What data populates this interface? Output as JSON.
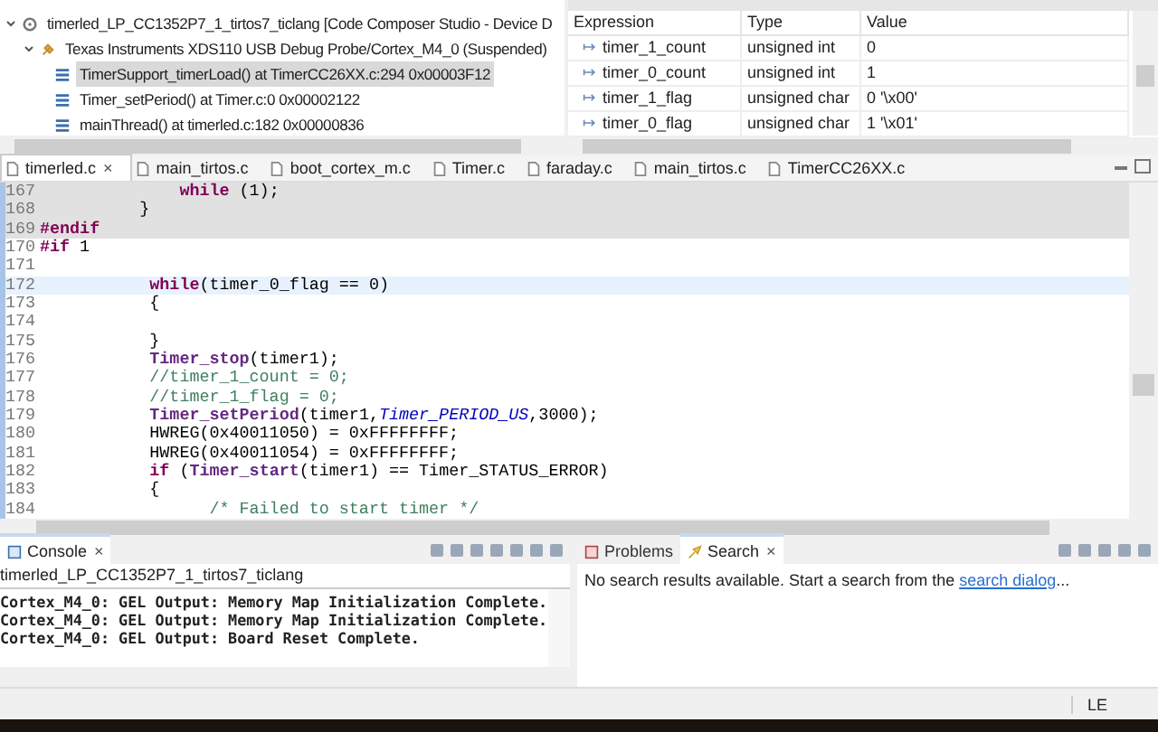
{
  "debug_tree": [
    {
      "label": "timerled_LP_CC1352P7_1_tirtos7_ticlang [Code Composer Studio - Device D",
      "kind": "project",
      "expanded": true,
      "children": [
        {
          "label": "Texas Instruments XDS110 USB Debug Probe/Cortex_M4_0 (Suspended)",
          "kind": "probe",
          "expanded": true,
          "children": [
            {
              "label": "TimerSupport_timerLoad() at TimerCC26XX.c:294 0x00003F12",
              "kind": "frame",
              "selected": true
            },
            {
              "label": "Timer_setPeriod() at Timer.c:0 0x00002122",
              "kind": "frame",
              "selected": false
            },
            {
              "label": "mainThread() at timerled.c:182 0x00000836",
              "kind": "frame",
              "selected": false
            }
          ]
        }
      ]
    }
  ],
  "expressions": {
    "columns": [
      "Expression",
      "Type",
      "Value"
    ],
    "rows": [
      {
        "expression": "timer_1_count",
        "type": "unsigned int",
        "value": "0"
      },
      {
        "expression": "timer_0_count",
        "type": "unsigned int",
        "value": "1"
      },
      {
        "expression": "timer_1_flag",
        "type": "unsigned char",
        "value": "0 '\\x00'"
      },
      {
        "expression": "timer_0_flag",
        "type": "unsigned char",
        "value": "1 '\\x01'"
      }
    ]
  },
  "editor_tabs": [
    {
      "label": "timerled.c",
      "close": "×",
      "selected": true
    },
    {
      "label": "main_tirtos.c",
      "selected": false
    },
    {
      "label": "boot_cortex_m.c",
      "selected": false
    },
    {
      "label": "Timer.c",
      "selected": false
    },
    {
      "label": "faraday.c",
      "selected": false
    },
    {
      "label": "main_tirtos.c",
      "selected": false
    },
    {
      "label": "TimerCC26XX.c",
      "selected": false
    }
  ],
  "code": [
    {
      "number": "167",
      "inactive": true,
      "current": false,
      "tokens": [
        {
          "text": "              while",
          "kind": "keyword"
        },
        {
          "text": " (1);",
          "kind": "plain"
        }
      ]
    },
    {
      "number": "168",
      "inactive": true,
      "current": false,
      "tokens": [
        {
          "text": "          }",
          "kind": "plain"
        }
      ]
    },
    {
      "number": "169",
      "inactive": true,
      "current": false,
      "tokens": [
        {
          "text": "#endif",
          "kind": "keyword"
        }
      ]
    },
    {
      "number": "170",
      "inactive": false,
      "current": false,
      "tokens": [
        {
          "text": "#if",
          "kind": "keyword"
        },
        {
          "text": " 1",
          "kind": "plain"
        }
      ]
    },
    {
      "number": "171",
      "inactive": false,
      "current": false
    },
    {
      "number": "172",
      "inactive": false,
      "current": true,
      "tokens": [
        {
          "text": "           while",
          "kind": "keyword"
        },
        {
          "text": "(timer_0_flag == 0)",
          "kind": "plain"
        }
      ]
    },
    {
      "number": "173",
      "inactive": false,
      "current": false,
      "tokens": [
        {
          "text": "           {",
          "kind": "plain"
        }
      ]
    },
    {
      "number": "174",
      "inactive": false,
      "current": false
    },
    {
      "number": "175",
      "inactive": false,
      "current": false,
      "tokens": [
        {
          "text": "           }",
          "kind": "plain"
        }
      ]
    },
    {
      "number": "176",
      "inactive": false,
      "current": false,
      "tokens": [
        {
          "text": "           Timer_stop",
          "kind": "func"
        },
        {
          "text": "(timer1);",
          "kind": "plain"
        }
      ]
    },
    {
      "number": "177",
      "inactive": false,
      "current": false,
      "tokens": [
        {
          "text": "           //timer_1_count = 0;",
          "kind": "comment"
        }
      ]
    },
    {
      "number": "178",
      "inactive": false,
      "current": false,
      "tokens": [
        {
          "text": "           //timer_1_flag = 0;",
          "kind": "comment"
        }
      ]
    },
    {
      "number": "179",
      "inactive": false,
      "current": false,
      "tokens": [
        {
          "text": "           Timer_setPeriod",
          "kind": "func"
        },
        {
          "text": "(timer1,",
          "kind": "plain"
        },
        {
          "text": "Timer_PERIOD_US",
          "kind": "constant"
        },
        {
          "text": ",3000);",
          "kind": "plain"
        }
      ]
    },
    {
      "number": "180",
      "inactive": false,
      "current": false,
      "tokens": [
        {
          "text": "           HWREG(0x40011050) = 0xFFFFFFFF;",
          "kind": "plain"
        }
      ]
    },
    {
      "number": "181",
      "inactive": false,
      "current": false,
      "tokens": [
        {
          "text": "           HWREG(0x40011054) = 0xFFFFFFFF;",
          "kind": "plain"
        }
      ]
    },
    {
      "number": "182",
      "inactive": false,
      "current": false,
      "tokens": [
        {
          "text": "           if",
          "kind": "keyword"
        },
        {
          "text": " (",
          "kind": "plain"
        },
        {
          "text": "Timer_start",
          "kind": "func"
        },
        {
          "text": "(timer1) == Timer_STATUS_ERROR)",
          "kind": "plain"
        }
      ]
    },
    {
      "number": "183",
      "inactive": false,
      "current": false,
      "tokens": [
        {
          "text": "           {",
          "kind": "plain"
        }
      ]
    },
    {
      "number": "184",
      "inactive": false,
      "current": false,
      "tokens": [
        {
          "text": "                 /* Failed to start timer */",
          "kind": "comment"
        }
      ]
    }
  ],
  "console": {
    "tab": "Console",
    "close": "×",
    "subtitle": "timerled_LP_CC1352P7_1_tirtos7_ticlang",
    "lines": [
      "Cortex_M4_0: GEL Output: Memory Map Initialization Complete.",
      "Cortex_M4_0: GEL Output: Memory Map Initialization Complete.",
      "Cortex_M4_0: GEL Output: Board Reset Complete."
    ]
  },
  "search_panel": {
    "tabs": [
      {
        "label": "Problems",
        "kind": "problems",
        "selected": false
      },
      {
        "label": "Search",
        "kind": "search",
        "close": "×",
        "selected": true
      }
    ],
    "message": "No search results available. Start a search from the ",
    "link": "search dialog",
    "suffix": "..."
  },
  "status_bar": {
    "encoding": "LE"
  }
}
